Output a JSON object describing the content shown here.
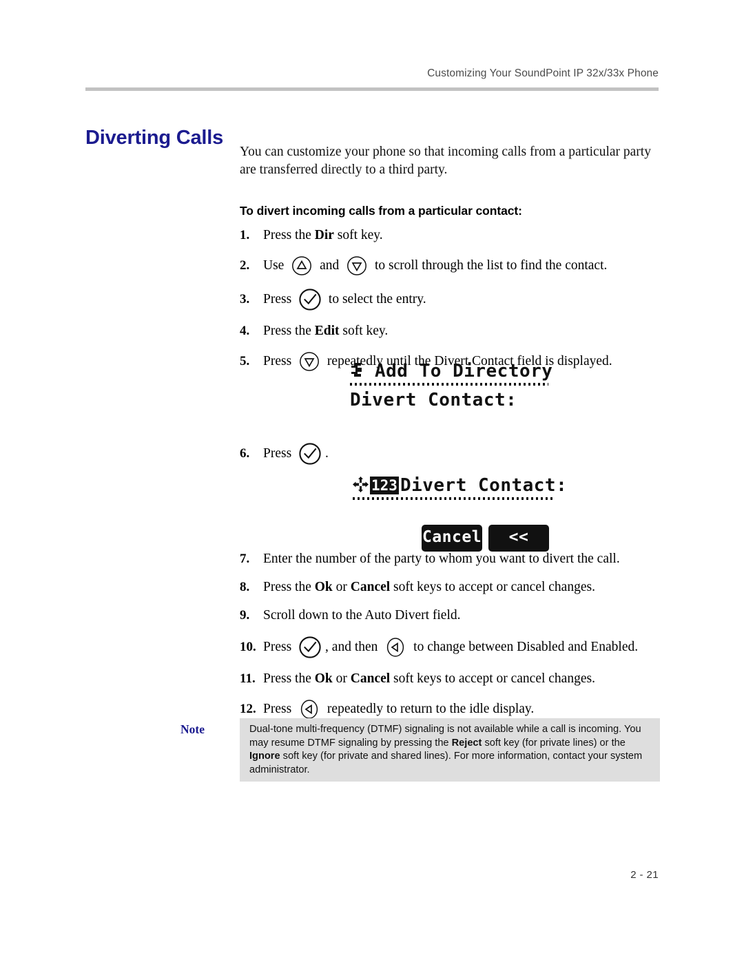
{
  "header": {
    "running_head": "Customizing Your SoundPoint IP 32x/33x Phone"
  },
  "section": {
    "title": "Diverting Calls",
    "title_color": "#1b1b8f",
    "intro": "You can customize your phone so that incoming calls from a particular party are transferred directly to a third party.",
    "sub_heading": "To divert incoming calls from a particular contact:"
  },
  "steps": [
    {
      "num": "1.",
      "pre": "Press the ",
      "bold": "Dir",
      "post": " soft key.",
      "icons": []
    },
    {
      "num": "2.",
      "pre": "Use ",
      "mid": " and ",
      "post": " to scroll through the list to find the contact.",
      "icons": [
        "arrow-up-key-icon",
        "arrow-down-key-icon"
      ]
    },
    {
      "num": "3.",
      "pre": "Press ",
      "post": " to select the entry.",
      "icons": [
        "checkmark-key-icon"
      ]
    },
    {
      "num": "4.",
      "pre": "Press the ",
      "bold": "Edit",
      "post": " soft key.",
      "icons": []
    },
    {
      "num": "5.",
      "pre": "Press ",
      "post": " repeatedly until the Divert Contact field is displayed.",
      "icons": [
        "arrow-down-key-icon"
      ]
    },
    {
      "num": "6.",
      "pre": "Press ",
      "post": ".",
      "icons": [
        "checkmark-key-icon"
      ]
    },
    {
      "num": "7.",
      "pre": "Enter the number of the party to whom you want to divert the call.",
      "icons": []
    },
    {
      "num": "8.",
      "pre": "Press the ",
      "bold": "Ok",
      "mid_text": " or ",
      "bold2": "Cancel",
      "post": " soft keys to accept or cancel changes.",
      "icons": []
    },
    {
      "num": "9.",
      "pre": "Scroll down to the Auto Divert field.",
      "icons": []
    },
    {
      "num": "10.",
      "pre": "Press ",
      "mid": ", and then ",
      "post": " to change between Disabled and Enabled.",
      "icons": [
        "checkmark-key-icon",
        "arrow-left-key-icon"
      ]
    },
    {
      "num": "11.",
      "pre": "Press the ",
      "bold": "Ok",
      "mid_text": " or ",
      "bold2": "Cancel",
      "post": " soft keys to accept or cancel changes.",
      "icons": []
    },
    {
      "num": "12.",
      "pre": "Press ",
      "post": " repeatedly to return to the idle display.",
      "icons": [
        "arrow-left-key-icon"
      ]
    }
  ],
  "lcd_screen_1": {
    "icon": "phone-handset-icon",
    "title": "Add To Directory",
    "field_label": "Divert Contact:"
  },
  "lcd_screen_2": {
    "icon": "navigation-cross-icon",
    "mode_badge": "123",
    "title": "Divert Contact:",
    "softkeys": [
      {
        "name": "cancel",
        "label": "Cancel"
      },
      {
        "name": "backspace",
        "label": "<<"
      }
    ]
  },
  "note": {
    "label": "Note",
    "label_color": "#1b1b8f",
    "background": "#dedede",
    "line1_a": "Dual-tone multi-frequency (DTMF) signaling is not available while a call is incoming. You may resume DTMF signaling by pressing the ",
    "bold1": "Reject",
    "line1_b": " soft key (for private lines) or the ",
    "bold2": "Ignore",
    "line1_c": " soft key (for private and shared lines). For more information, contact your system administrator."
  },
  "footer": {
    "page_number": "2 - 21"
  }
}
